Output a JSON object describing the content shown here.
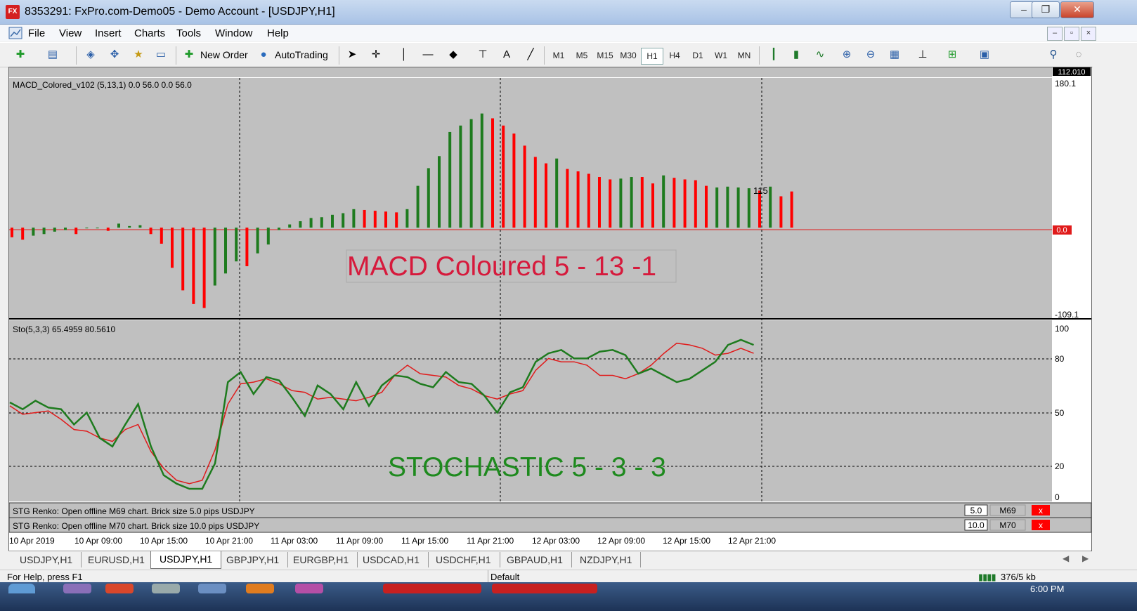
{
  "window": {
    "title": "8353291: FxPro.com-Demo05 - Demo Account - [USDJPY,H1]",
    "app_icon_text": "FX",
    "minimize": "–",
    "restore": "❐",
    "close": "✕"
  },
  "menu": {
    "items": [
      "File",
      "View",
      "Insert",
      "Charts",
      "Tools",
      "Window",
      "Help"
    ],
    "mdi_min": "–",
    "mdi_restore": "▫",
    "mdi_close": "×"
  },
  "toolbar": {
    "new_order": "New Order",
    "autotrading": "AutoTrading",
    "timeframes": [
      "M1",
      "M5",
      "M15",
      "M30",
      "H1",
      "H4",
      "D1",
      "W1",
      "MN"
    ],
    "active_timeframe": "H1"
  },
  "chart": {
    "top_strip_price": "112.010",
    "macd_label": "MACD_Colored_v102 (5,13,1) 0.0 56.0 0.0 56.0",
    "macd_axis": {
      "top": "180.1",
      "zero": "0.0",
      "bottom": "-109.1"
    },
    "macd_annotation": "MACD Coloured  5 - 13 -1",
    "macd_last_value": "115",
    "sto_label": "Sto(5,3,3) 65.4959 80.5610",
    "sto_axis": [
      "100",
      "80",
      "50",
      "20",
      "0"
    ],
    "sto_annotation": "STOCHASTIC 5 - 3 - 3",
    "renko1": {
      "text": "STG Renko: Open offline M69 chart. Brick size 5.0 pips USDJPY",
      "value": "5.0",
      "tf": "M69",
      "x": "x"
    },
    "renko2": {
      "text": "STG Renko: Open offline M70 chart. Brick size 10.0 pips USDJPY",
      "value": "10.0",
      "tf": "M70",
      "x": "x"
    },
    "x_labels": [
      "10 Apr 2019",
      "10 Apr 09:00",
      "10 Apr 15:00",
      "10 Apr 21:00",
      "11 Apr 03:00",
      "11 Apr 09:00",
      "11 Apr 15:00",
      "11 Apr 21:00",
      "12 Apr 03:00",
      "12 Apr 09:00",
      "12 Apr 15:00",
      "12 Apr 21:00"
    ]
  },
  "chart_data": [
    {
      "type": "bar",
      "title": "MACD_Colored_v102 (5,13,1) 0.0 56.0 0.0 56.0",
      "ylim": [
        -109.1,
        180.1
      ],
      "values": [
        -12,
        -15,
        -10,
        -8,
        -5,
        -3,
        -8,
        0,
        0,
        -4,
        5,
        2,
        3,
        -8,
        -20,
        -50,
        -78,
        -95,
        -100,
        -72,
        -57,
        -42,
        -48,
        -32,
        -21,
        -3,
        4,
        8,
        12,
        13,
        16,
        18,
        23,
        22,
        21,
        20,
        19,
        23,
        52,
        74,
        89,
        119,
        127,
        135,
        142,
        136,
        127,
        117,
        102,
        88,
        80,
        86,
        73,
        70,
        67,
        63,
        60,
        61,
        63,
        63,
        55,
        65,
        62,
        60,
        59,
        52,
        50,
        51,
        50,
        49,
        46,
        51,
        39,
        45
      ],
      "colors": [
        "r",
        "r",
        "g",
        "g",
        "g",
        "g",
        "r",
        "g",
        "g",
        "r",
        "g",
        "g",
        "g",
        "r",
        "r",
        "r",
        "r",
        "r",
        "r",
        "g",
        "g",
        "g",
        "r",
        "g",
        "g",
        "g",
        "g",
        "g",
        "g",
        "g",
        "g",
        "g",
        "g",
        "r",
        "r",
        "r",
        "r",
        "g",
        "g",
        "g",
        "g",
        "g",
        "g",
        "g",
        "g",
        "r",
        "r",
        "r",
        "r",
        "r",
        "r",
        "g",
        "r",
        "r",
        "r",
        "r",
        "r",
        "g",
        "g",
        "r",
        "r",
        "g",
        "r",
        "r",
        "r",
        "r",
        "g",
        "g",
        "g",
        "g",
        "r",
        "g",
        "r",
        "r"
      ]
    },
    {
      "type": "line",
      "title": "Sto(5,3,3) 65.4959 80.5610",
      "ylim": [
        0,
        100
      ],
      "series": [
        {
          "name": "Sto main",
          "color": "#1e7b1e",
          "values": [
            56,
            52,
            57,
            53,
            52,
            43,
            50,
            35,
            30,
            43,
            55,
            30,
            13,
            8,
            5,
            5,
            20,
            68,
            74,
            61,
            71,
            69,
            59,
            48,
            66,
            61,
            52,
            68,
            54,
            66,
            72,
            71,
            67,
            65,
            74,
            68,
            67,
            60,
            50,
            62,
            65,
            80,
            85,
            87,
            82,
            82,
            86,
            87,
            84,
            73,
            76,
            72,
            68,
            70,
            75,
            80,
            90,
            93,
            90
          ]
        },
        {
          "name": "Sto signal",
          "color": "#e01b1b",
          "values": [
            54,
            49,
            50,
            51,
            46,
            40,
            39,
            35,
            33,
            40,
            43,
            27,
            17,
            10,
            8,
            10,
            28,
            55,
            67,
            68,
            70,
            67,
            63,
            62,
            58,
            59,
            58,
            57,
            59,
            62,
            72,
            78,
            73,
            72,
            71,
            66,
            64,
            60,
            58,
            61,
            63,
            75,
            82,
            80,
            80,
            78,
            72,
            72,
            70,
            73,
            78,
            85,
            91,
            90,
            88,
            84,
            85,
            88,
            85
          ]
        }
      ]
    }
  ],
  "tabs": [
    "USDJPY,H1",
    "EURUSD,H1",
    "USDJPY,H1",
    "GBPJPY,H1",
    "EURGBP,H1",
    "USDCAD,H1",
    "USDCHF,H1",
    "GBPAUD,H1",
    "NZDJPY,H1"
  ],
  "active_tab_index": 2,
  "status": {
    "help": "For Help, press F1",
    "profile": "Default",
    "traffic": "376/5 kb"
  },
  "taskbar": {
    "clock": "6:00 PM"
  }
}
